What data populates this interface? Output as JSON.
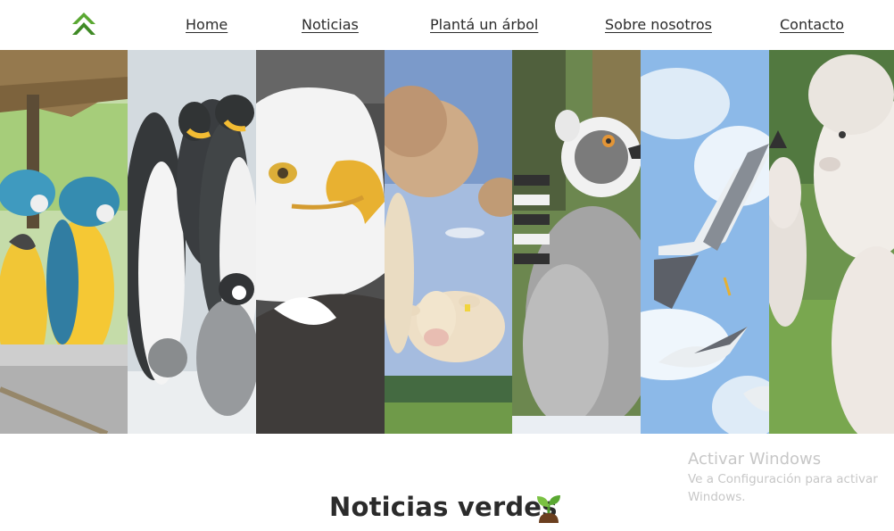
{
  "nav": {
    "logo_icon": "double-chevron-up-icon",
    "items": [
      {
        "label": "Home"
      },
      {
        "label": "Noticias"
      },
      {
        "label": "Plantá un árbol"
      },
      {
        "label": "Sobre nosotros"
      },
      {
        "label": "Contacto"
      }
    ]
  },
  "hero": {
    "panels": [
      {
        "subject": "macaws",
        "icon": "macaw-image"
      },
      {
        "subject": "penguins",
        "icon": "penguin-image"
      },
      {
        "subject": "bald-eagle",
        "icon": "eagle-image"
      },
      {
        "subject": "cows",
        "icon": "cow-image"
      },
      {
        "subject": "lemur",
        "icon": "lemur-image"
      },
      {
        "subject": "seagulls",
        "icon": "seagull-image"
      },
      {
        "subject": "alpacas",
        "icon": "alpaca-image"
      }
    ]
  },
  "section": {
    "title": "Noticias verdes",
    "icon": "sprout-icon"
  },
  "watermark": {
    "title": "Activar Windows",
    "line1": "Ve a Configuración para activar",
    "line2": "Windows."
  },
  "colors": {
    "logo_green": "#4e9a2c",
    "text_dark": "#2b2b2b",
    "watermark_gray": "#c7c7c7"
  }
}
